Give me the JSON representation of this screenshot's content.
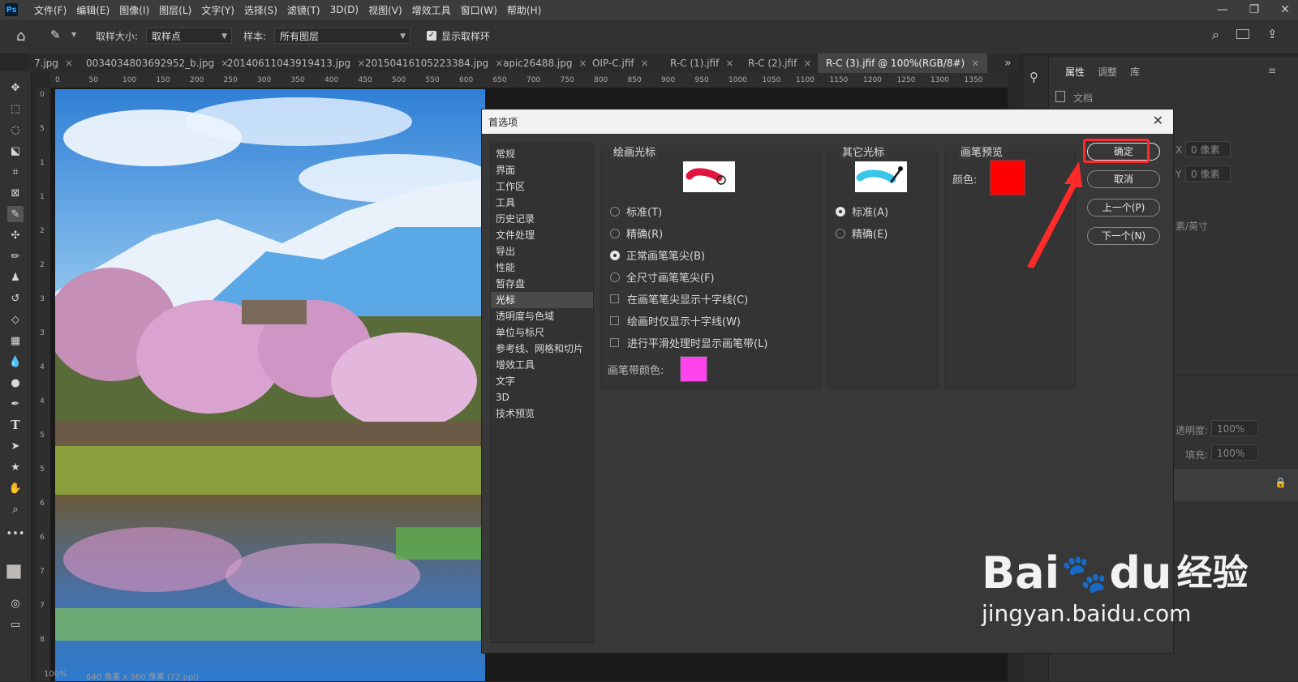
{
  "menu": {
    "logo": "Ps",
    "items": [
      "文件(F)",
      "编辑(E)",
      "图像(I)",
      "图层(L)",
      "文字(Y)",
      "选择(S)",
      "滤镜(T)",
      "3D(D)",
      "视图(V)",
      "增效工具",
      "窗口(W)",
      "帮助(H)"
    ]
  },
  "options": {
    "sample_size_label": "取样大小:",
    "sample_size_value": "取样点",
    "sample_label": "样本:",
    "sample_value": "所有图层",
    "show_ring_label": "显示取样环"
  },
  "tabs": [
    {
      "label": "7.jpg"
    },
    {
      "label": "0034034803692952_b.jpg"
    },
    {
      "label": "20140611043919413.jpg"
    },
    {
      "label": "20150416105223384.jpg"
    },
    {
      "label": "apic26488.jpg"
    },
    {
      "label": "OIP-C.jfif"
    },
    {
      "label": "R-C (1).jfif"
    },
    {
      "label": "R-C (2).jfif"
    },
    {
      "label": "R-C (3).jfif @ 100%(RGB/8#)"
    }
  ],
  "tab_overflow": "»",
  "ruler_top": [
    "0",
    "50",
    "100",
    "150",
    "200",
    "250",
    "300",
    "350",
    "400",
    "450",
    "500",
    "550",
    "600",
    "650",
    "700",
    "750",
    "800",
    "850",
    "900",
    "950",
    "1000",
    "1050",
    "1100",
    "1150",
    "1200",
    "1250",
    "1300",
    "1350"
  ],
  "ruler_left": [
    "0",
    "5",
    "1",
    "1",
    "2",
    "2",
    "3",
    "3",
    "4",
    "4",
    "5",
    "5",
    "6",
    "6",
    "7",
    "7",
    "8"
  ],
  "right_panel": {
    "tabs": [
      "属性",
      "调整",
      "库"
    ],
    "doc_label": "文档",
    "x_label": "X",
    "x_value": "0 像素",
    "y_label": "Y",
    "y_value": "0 像素",
    "units": "素/英寸",
    "opacity_label": "透明度:",
    "opacity_value": "100%",
    "fill_label": "填充:",
    "fill_value": "100%"
  },
  "status": {
    "zoom": "100%",
    "info": "640 像素 x 960 像素 (72 ppi)"
  },
  "dialog": {
    "title": "首选项",
    "nav": [
      "常规",
      "界面",
      "工作区",
      "工具",
      "历史记录",
      "文件处理",
      "导出",
      "性能",
      "暂存盘",
      "光标",
      "透明度与色域",
      "单位与标尺",
      "参考线、网格和切片",
      "增效工具",
      "文字",
      "3D",
      "技术预览"
    ],
    "selected_nav": "光标",
    "painting_cursors": {
      "label": "绘画光标",
      "options": [
        "标准(T)",
        "精确(R)",
        "正常画笔笔尖(B)",
        "全尺寸画笔笔尖(F)"
      ],
      "selected": "正常画笔笔尖(B)",
      "checks": [
        "在画笔笔尖显示十字线(C)",
        "绘画时仅显示十字线(W)",
        "进行平滑处理时显示画笔带(L)"
      ],
      "brush_leash_label": "画笔带颜色:",
      "brush_leash_color": "#ff44ee"
    },
    "other_cursors": {
      "label": "其它光标",
      "options": [
        "标准(A)",
        "精确(E)"
      ],
      "selected": "标准(A)"
    },
    "brush_preview": {
      "label": "画笔预览",
      "color_label": "颜色:",
      "color": "#ff0000"
    },
    "buttons": {
      "ok": "确定",
      "cancel": "取消",
      "prev": "上一个(P)",
      "next": "下一个(N)"
    }
  },
  "annotation_color": "#ff2a2a",
  "watermark": {
    "brand": "Bai",
    "brand_du": "du",
    "cn": "经验",
    "url": "jingyan.baidu.com"
  }
}
